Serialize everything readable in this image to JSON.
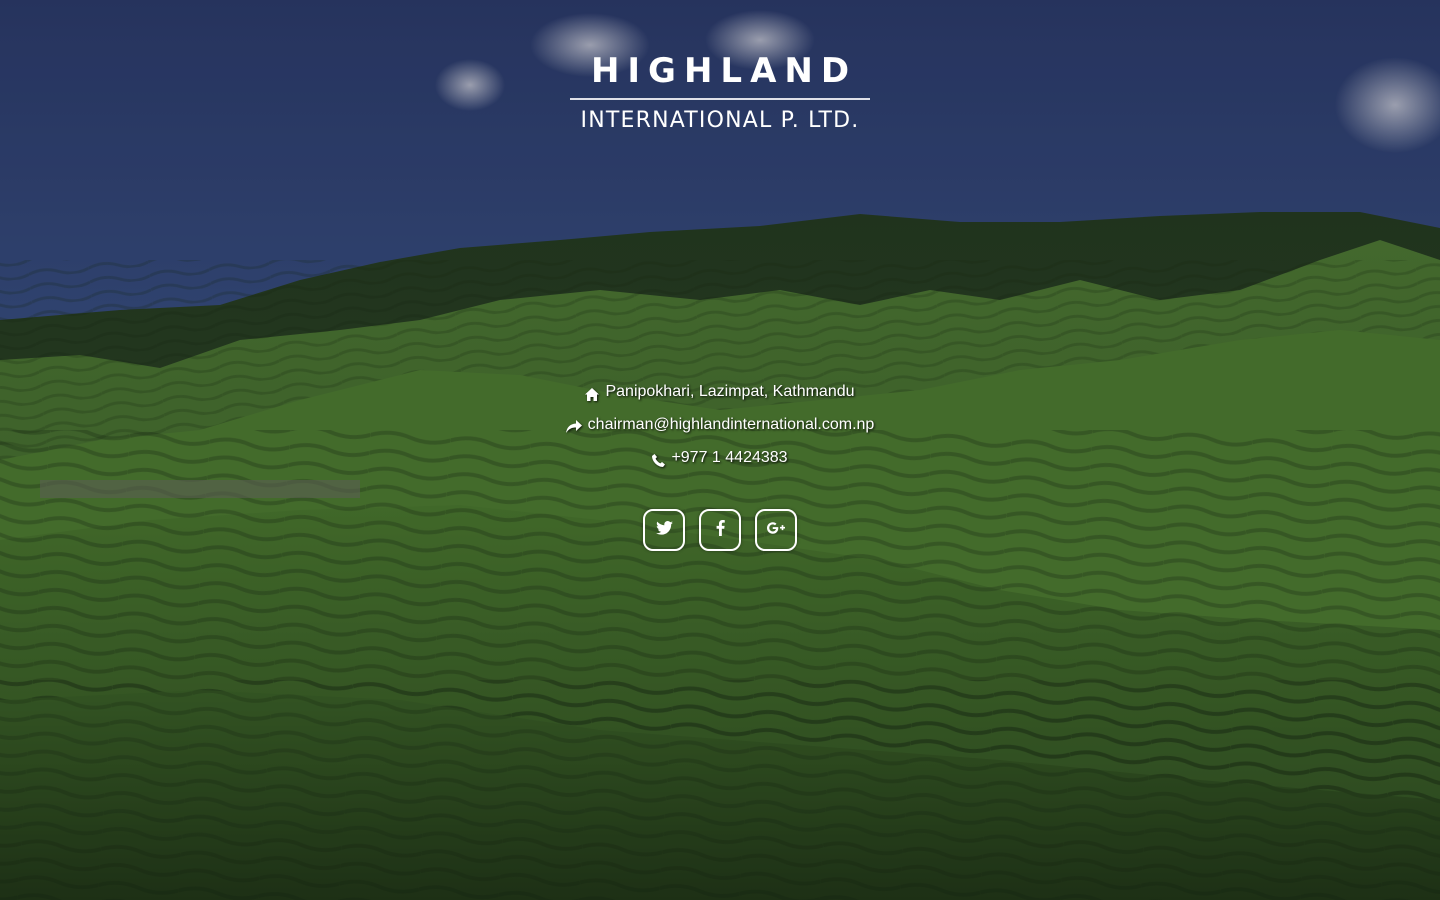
{
  "logo": {
    "name": "HIGHLAND",
    "subtitle": "INTERNATIONAL P. LTD."
  },
  "contact": {
    "address": "Panipokhari, Lazimpat, Kathmandu",
    "email": "chairman@highlandinternational.com.np",
    "phone": "+977 1 4424383",
    "address_icon": "home-icon",
    "email_icon": "share-icon",
    "phone_icon": "phone-icon"
  },
  "social": [
    {
      "network": "twitter",
      "icon": "twitter-icon"
    },
    {
      "network": "facebook",
      "icon": "facebook-icon"
    },
    {
      "network": "google-plus",
      "icon": "google-plus-icon"
    }
  ],
  "colors": {
    "sky": "#2e4577",
    "hills_dark": "#2f4a22",
    "hills_light": "#5e8a3a",
    "text": "#ffffff"
  }
}
